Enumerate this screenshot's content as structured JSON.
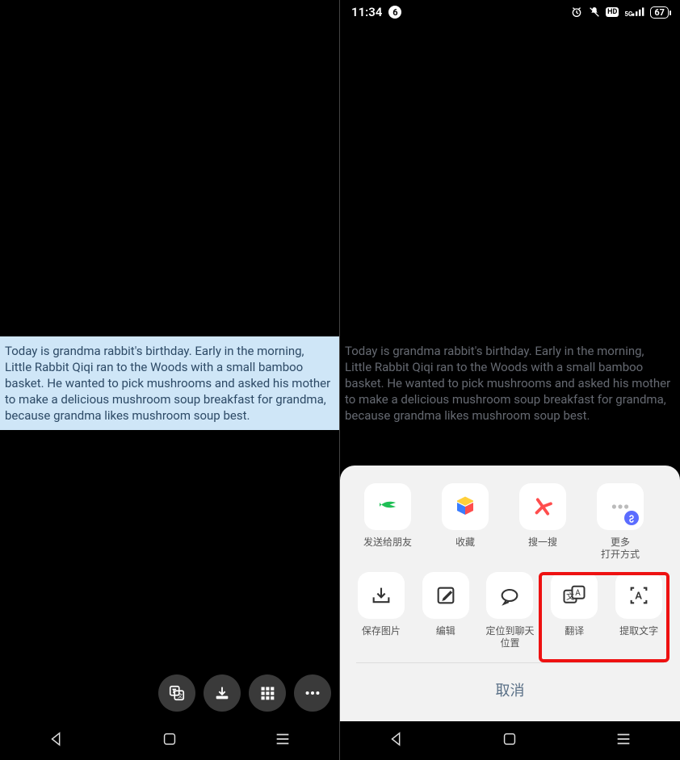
{
  "story_text": "Today is grandma rabbit's birthday. Early in the morning, Little Rabbit Qiqi ran to the Woods with a small bamboo basket. He wanted to pick mushrooms and asked his mother to make a delicious mushroom soup breakfast for grandma, because grandma likes mushroom soup best.",
  "statusbar": {
    "time": "11:34",
    "dot": "6",
    "hd": "HD",
    "net_sup": "5G",
    "battery": "67"
  },
  "sheet": {
    "row1": [
      {
        "label": "发送给朋友"
      },
      {
        "label": "收藏"
      },
      {
        "label": "搜一搜"
      },
      {
        "label": "更多\n打开方式"
      }
    ],
    "row2": [
      {
        "label": "保存图片"
      },
      {
        "label": "编辑"
      },
      {
        "label": "定位到聊天\n位置"
      },
      {
        "label": "翻译"
      },
      {
        "label": "提取文字"
      }
    ],
    "cancel": "取消"
  }
}
